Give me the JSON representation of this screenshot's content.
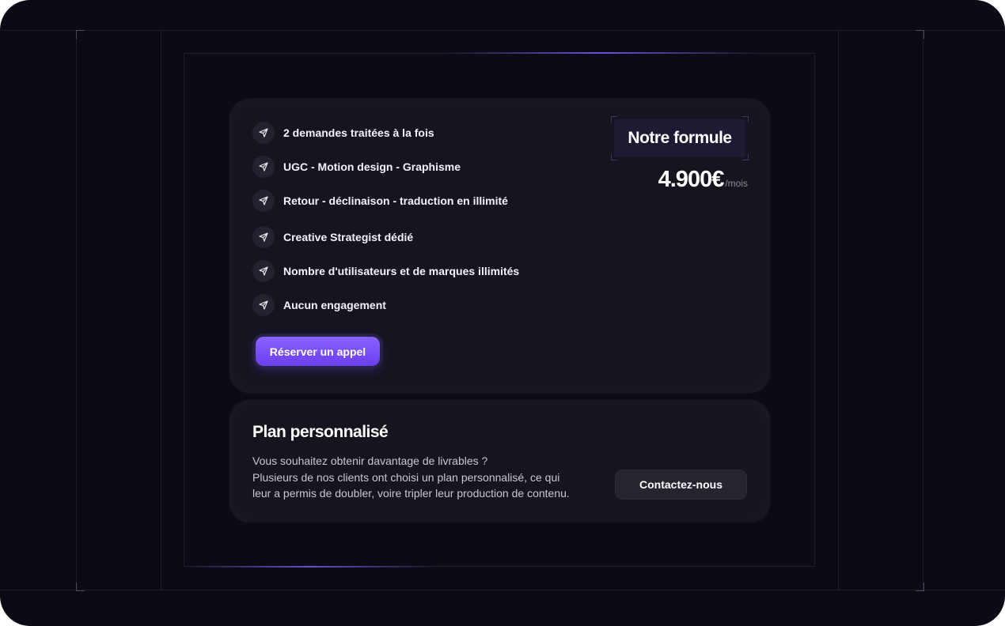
{
  "pricing": {
    "features": [
      {
        "label": "2 demandes traitées à la fois",
        "icon": "send-icon"
      },
      {
        "label": "UGC - Motion design - Graphisme",
        "icon": "send-icon"
      },
      {
        "label": "Retour - déclinaison - traduction en illimité",
        "icon": "send-icon"
      },
      {
        "label": "Creative Strategist dédié",
        "icon": "send-icon"
      },
      {
        "label": "Nombre d'utilisateurs et de marques illimités",
        "icon": "send-icon"
      },
      {
        "label": "Aucun engagement",
        "icon": "send-icon"
      }
    ],
    "cta_label": "Réserver un appel",
    "badge_label": "Notre formule",
    "price": "4.900€",
    "price_unit": "/mois"
  },
  "custom_plan": {
    "title": "Plan personnalisé",
    "description_lines": [
      "Vous souhaitez obtenir davantage de livrables ?",
      "Plusieurs de nos clients ont choisi un plan personnalisé, ce qui",
      "leur a permis de doubler, voire tripler leur production de contenu."
    ],
    "contact_label": "Contactez-nous"
  },
  "colors": {
    "background": "#0c0b15",
    "card": "#15141f",
    "accent": "#7c4dff",
    "badge_bg": "#1e1a33"
  }
}
